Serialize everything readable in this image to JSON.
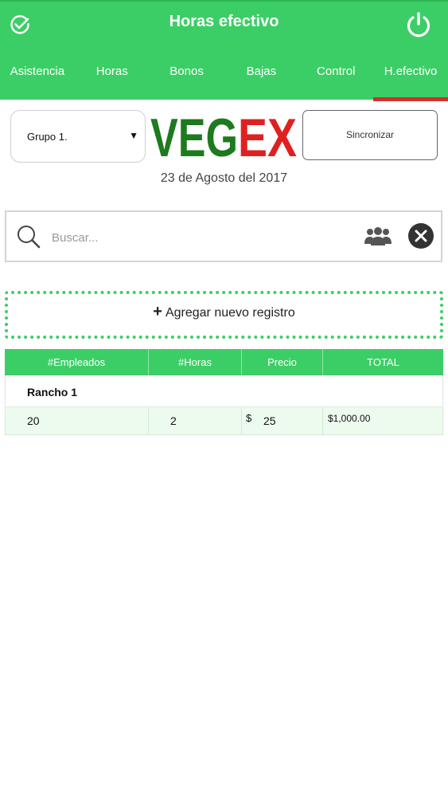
{
  "header": {
    "title": "Horas efectivo"
  },
  "tabs": [
    {
      "label": "Asistencia"
    },
    {
      "label": "Horas"
    },
    {
      "label": "Bonos"
    },
    {
      "label": "Bajas"
    },
    {
      "label": "Control"
    },
    {
      "label": "H.efectivo",
      "active": true
    }
  ],
  "group_select": {
    "value": "Grupo 1."
  },
  "logo": {
    "text": "VEGEX",
    "colors": {
      "veg": "#1e7a1e",
      "ex": "#e02020"
    }
  },
  "sync_button": {
    "label": "Sincronizar"
  },
  "date": "23 de Agosto del 2017",
  "search": {
    "placeholder": "Buscar..."
  },
  "add_record": {
    "plus": "+",
    "label": "Agregar nuevo registro"
  },
  "table": {
    "columns": [
      "#Empleados",
      "#Horas",
      "Precio",
      "TOTAL"
    ],
    "group": "Rancho 1",
    "rows": [
      {
        "empleados": "20",
        "horas": "2",
        "currency": "$",
        "precio": "25",
        "total": "$1,000.00"
      }
    ]
  },
  "colors": {
    "accent": "#3cce66",
    "active_tab_indicator": "#d32f2f"
  }
}
